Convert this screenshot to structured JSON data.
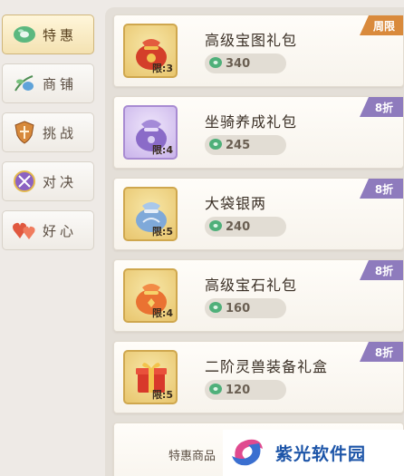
{
  "tabs": [
    {
      "label": "特惠",
      "icon": "jade-icon",
      "active": true
    },
    {
      "label": "商铺",
      "icon": "herb-icon",
      "active": false
    },
    {
      "label": "挑战",
      "icon": "shield-icon",
      "active": false
    },
    {
      "label": "对决",
      "icon": "crossed-swords-icon",
      "active": false
    },
    {
      "label": "好心",
      "icon": "hearts-icon",
      "active": false
    }
  ],
  "items": [
    {
      "name": "高级宝图礼包",
      "price": "340",
      "limit": "限:3",
      "badge": "周限",
      "icon": "red-treasure-bag-icon"
    },
    {
      "name": "坐骑养成礼包",
      "price": "245",
      "limit": "限:4",
      "badge": "8折",
      "icon": "purple-pouch-icon"
    },
    {
      "name": "大袋银两",
      "price": "240",
      "limit": "限:5",
      "badge": "8折",
      "icon": "silver-bag-icon"
    },
    {
      "name": "高级宝石礼包",
      "price": "160",
      "limit": "限:4",
      "badge": "8折",
      "icon": "orange-gem-bag-icon"
    },
    {
      "name": "二阶灵兽装备礼盒",
      "price": "120",
      "limit": "限:5",
      "badge": "8折",
      "icon": "red-gift-box-icon"
    }
  ],
  "footer": {
    "text": "特惠商品"
  },
  "watermark": {
    "text": "紫光软件园"
  },
  "colors": {
    "badge_discount": "#8e7bbd",
    "badge_weekly": "#d98a3c",
    "price_currency": "#4fb07a"
  }
}
